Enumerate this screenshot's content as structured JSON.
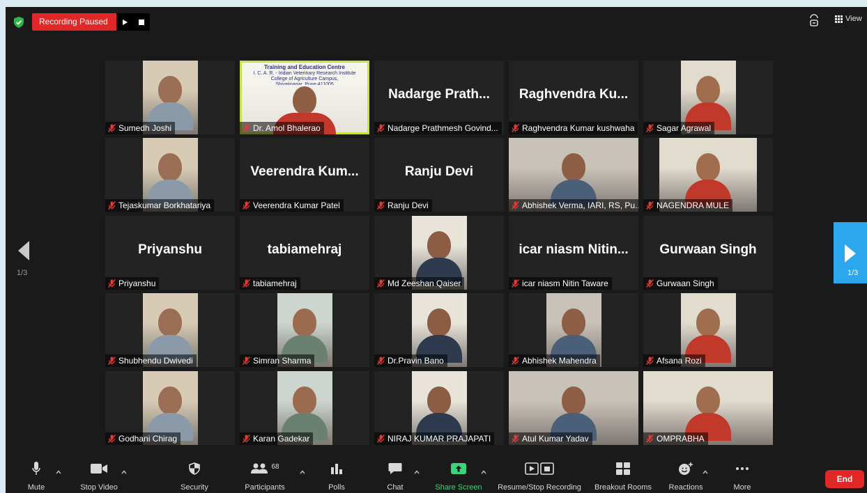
{
  "recording": {
    "status": "Recording Paused"
  },
  "view_label": "View",
  "page_indicator": "1/3",
  "active_speaker": "Dr. Amol Bhalerao",
  "banner": {
    "title": "Training and Education Centre",
    "line1": "I. C. A. R. - Indian Veterinary Research Institute",
    "line2": "College of Agriculture Campus,",
    "line3": "Shivajinagar, Pune-411005"
  },
  "participants": [
    {
      "label": "Sumedh Joshi",
      "video": true
    },
    {
      "label": "Dr. Amol Bhalerao",
      "video": true,
      "active": true
    },
    {
      "label": "Nadarge Prathmesh Govind...",
      "display": "Nadarge  Prath...",
      "video": false
    },
    {
      "label": "Raghvendra Kumar kushwaha",
      "display": "Raghvendra  Ku...",
      "video": false
    },
    {
      "label": "Sagar Agrawal",
      "video": true
    },
    {
      "label": "Tejaskumar Borkhatariya",
      "video": true
    },
    {
      "label": "Veerendra Kumar Patel",
      "display": "Veerendra  Kum...",
      "video": false
    },
    {
      "label": "Ranju Devi",
      "display": "Ranju Devi",
      "video": false
    },
    {
      "label": "Abhishek Verma, IARI, RS, Pu...",
      "video": true
    },
    {
      "label": "NAGENDRA MULE",
      "video": true
    },
    {
      "label": "Priyanshu",
      "display": "Priyanshu",
      "video": false
    },
    {
      "label": "tabiamehraj",
      "display": "tabiamehraj",
      "video": false
    },
    {
      "label": "Md Zeeshan Qaiser",
      "video": true
    },
    {
      "label": "icar niasm Nitin Taware",
      "display": "icar niasm Nitin...",
      "video": false
    },
    {
      "label": "Gurwaan Singh",
      "display": "Gurwaan Singh",
      "video": false
    },
    {
      "label": "Shubhendu Dwivedi",
      "video": true
    },
    {
      "label": "Simran Sharma",
      "video": true
    },
    {
      "label": "Dr.Pravin Bano",
      "video": true
    },
    {
      "label": "Abhishek Mahendra",
      "video": true
    },
    {
      "label": "Afsana Rozi",
      "video": true
    },
    {
      "label": "Godhani Chirag",
      "video": true
    },
    {
      "label": "Karan Gadekar",
      "video": true
    },
    {
      "label": "NIRAJ KUMAR PRAJAPATI",
      "video": true
    },
    {
      "label": "Atul Kumar Yadav",
      "video": true
    },
    {
      "label": "OMPRABHA",
      "video": true
    }
  ],
  "toolbar": {
    "mute": "Mute",
    "stop_video": "Stop Video",
    "security": "Security",
    "participants": "Participants",
    "participants_count": "68",
    "polls": "Polls",
    "chat": "Chat",
    "share_screen": "Share Screen",
    "recording": "Resume/Stop Recording",
    "breakout_rooms": "Breakout Rooms",
    "reactions": "Reactions",
    "more": "More",
    "end": "End"
  },
  "colors": {
    "recording_red": "#e02828",
    "share_green": "#3dd37a",
    "active_outline": "#c8e246",
    "next_page_blue": "#2aa7ef",
    "mute_red": "#e53935"
  }
}
